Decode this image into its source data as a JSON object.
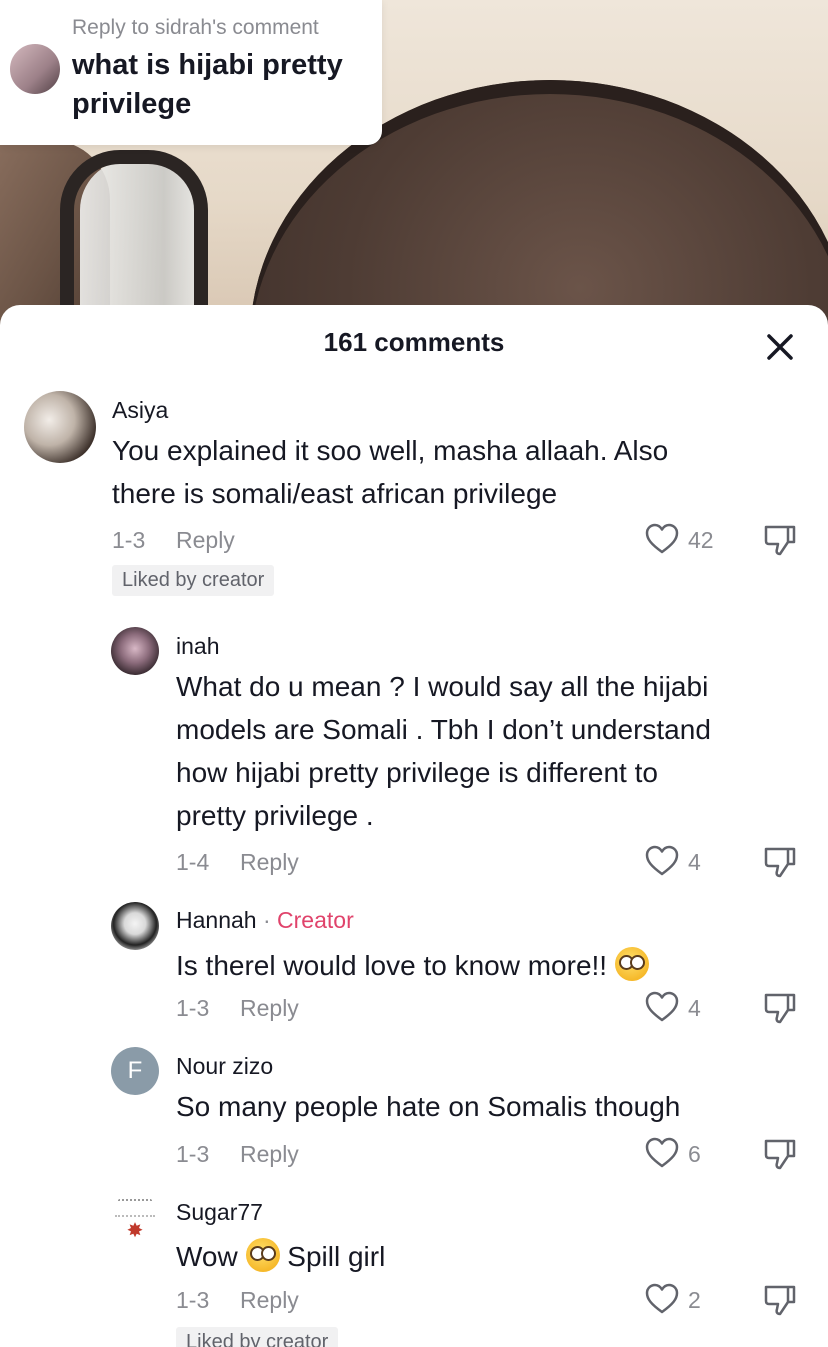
{
  "reply_card": {
    "title": "Reply to sidrah's comment",
    "question": "what is hijabi pretty privilege"
  },
  "sheet": {
    "title": "161 comments",
    "close_icon": "close-icon"
  },
  "comments": [
    {
      "username": "Asiya",
      "text_line1": "You explained it soo well, masha allaah. Also",
      "text_line2": "there is somali/east african privilege",
      "date": "1-3",
      "reply": "Reply",
      "likes": "42",
      "badge": "Liked by creator"
    },
    {
      "username": "inah",
      "text_line1": "What do u mean ? I would say all the hijabi",
      "text_line2": "models are Somali . Tbh I don’t understand",
      "text_line3": "how hijabi pretty privilege is different to",
      "text_line4": "pretty privilege .",
      "date": "1-4",
      "reply": "Reply",
      "likes": "4"
    },
    {
      "username": "Hannah",
      "creator_dot": "·",
      "creator_label": "Creator",
      "text": "Is therel would love to know more!!",
      "date": "1-3",
      "reply": "Reply",
      "likes": "4"
    },
    {
      "username": "Nour zizo",
      "avatar_letter": "F",
      "text": "So many people hate on Somalis though",
      "date": "1-3",
      "reply": "Reply",
      "likes": "6"
    },
    {
      "username": "Sugar77",
      "text_before": "Wow",
      "text_after": "Spill girl",
      "date": "1-3",
      "reply": "Reply",
      "likes": "2",
      "badge": "Liked by creator"
    }
  ],
  "colors": {
    "creator": "#e0436b",
    "muted": "#8a8b91",
    "text": "#161823"
  }
}
